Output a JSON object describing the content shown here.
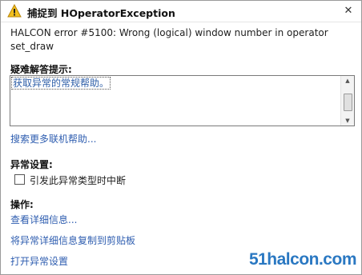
{
  "dialog": {
    "title": "捕捉到 HOperatorException",
    "close_glyph": "✕",
    "icon": "warning-icon"
  },
  "error_message": "HALCON error #5100: Wrong (logical) window number in operator set_draw",
  "help": {
    "label": "疑难解答提示:",
    "text": "获取异常的常规帮助。",
    "search_link": "搜索更多联机帮助..."
  },
  "exception_settings": {
    "label": "异常设置:",
    "checkbox_label": "引发此异常类型时中断",
    "checkbox_checked": false
  },
  "actions": {
    "label": "操作:",
    "items": [
      "查看详细信息...",
      "将异常详细信息复制到剪贴板",
      "打开异常设置"
    ]
  },
  "watermark": "51halcon.com",
  "colors": {
    "link": "#2f5eb0",
    "warning": "#f2c01e",
    "watermark": "#2a78c2"
  }
}
